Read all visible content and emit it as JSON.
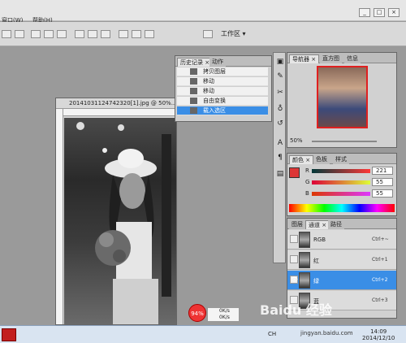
{
  "menubar": {
    "items": [
      "窗口(W)",
      "帮助(H)"
    ],
    "window_buttons": [
      "_",
      "□",
      "×"
    ]
  },
  "optbar": {
    "workspace_label": "工作区 ▾"
  },
  "document": {
    "title": "20141031124742320[1].jpg @ 50%..."
  },
  "history_panel": {
    "tabs": [
      "历史记录 ×",
      "动作"
    ],
    "rows": [
      {
        "label": "拷贝图层",
        "selected": false
      },
      {
        "label": "移动",
        "selected": false
      },
      {
        "label": "移动",
        "selected": false
      },
      {
        "label": "自由变换",
        "selected": false
      },
      {
        "label": "载入选区",
        "selected": true
      }
    ]
  },
  "navigator_panel": {
    "tabs": [
      "导航器 ×",
      "直方图",
      "信息"
    ],
    "zoom": "50%"
  },
  "color_panel": {
    "tabs": [
      "颜色 ×",
      "色板",
      "样式"
    ],
    "channels": [
      {
        "label": "R",
        "value": "221"
      },
      {
        "label": "G",
        "value": "55"
      },
      {
        "label": "B",
        "value": "55"
      }
    ],
    "swatch_color": "#dd3737"
  },
  "channels_panel": {
    "tabs": [
      "图层",
      "通道 ×",
      "路径"
    ],
    "rows": [
      {
        "name": "RGB",
        "shortcut": "Ctrl+~",
        "selected": false
      },
      {
        "name": "红",
        "shortcut": "Ctrl+1",
        "selected": false
      },
      {
        "name": "绿",
        "shortcut": "Ctrl+2",
        "selected": true
      },
      {
        "name": "蓝",
        "shortcut": "Ctrl+3",
        "selected": false
      }
    ]
  },
  "overlay": {
    "progress": "94%",
    "net_up": "0K/s",
    "net_down": "0K/s",
    "watermark": "Baidu 经验",
    "watermark_url": "jingyan.baidu.com"
  },
  "taskbar": {
    "lang": "CH",
    "time": "14:09",
    "date": "2014/12/10"
  },
  "colors": {
    "selection": "#3a8ee6",
    "accent_red": "#e33333"
  }
}
